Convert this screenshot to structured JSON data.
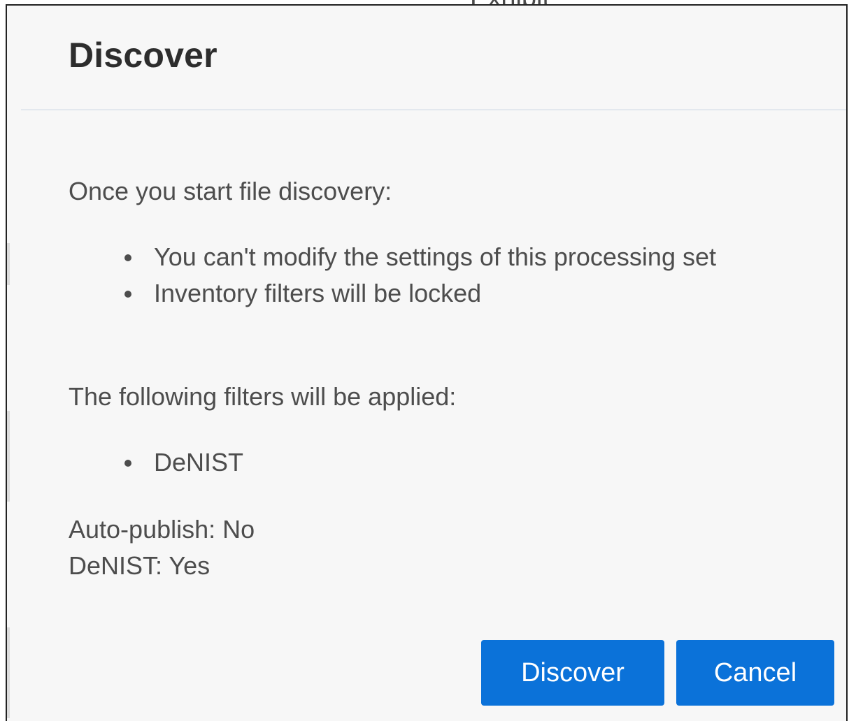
{
  "background_fragment": "Exhibit",
  "dialog": {
    "title": "Discover",
    "intro": "Once you start file discovery:",
    "warnings": [
      "You can't modify the settings of this processing set",
      "Inventory filters will be locked"
    ],
    "filters_heading": "The following filters will be applied:",
    "filters": [
      "DeNIST"
    ],
    "settings": [
      {
        "text": "Auto-publish: No"
      },
      {
        "text": "DeNIST: Yes"
      }
    ],
    "buttons": {
      "discover_label": "Discover",
      "cancel_label": "Cancel"
    }
  },
  "colors": {
    "primary_button": "#0b72d9",
    "dialog_background": "#f7f7f7",
    "text": "#4d4d4d"
  }
}
